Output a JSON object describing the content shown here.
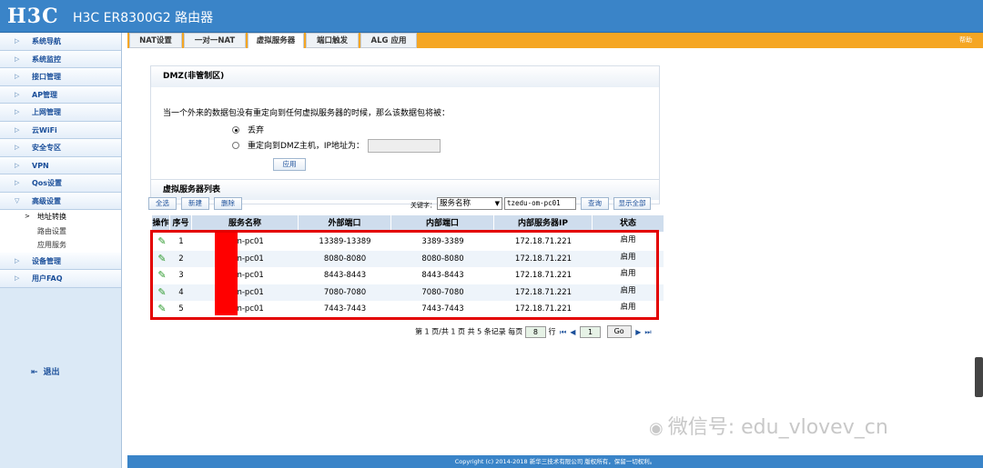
{
  "header": {
    "logo": "H3C",
    "product": "H3C ER8300G2 路由器"
  },
  "sidebar": {
    "items": [
      {
        "label": "系统导航"
      },
      {
        "label": "系统监控"
      },
      {
        "label": "接口管理"
      },
      {
        "label": "AP管理"
      },
      {
        "label": "上网管理"
      },
      {
        "label": "云WiFi"
      },
      {
        "label": "安全专区"
      },
      {
        "label": "VPN"
      },
      {
        "label": "Qos设置"
      },
      {
        "label": "高级设置"
      }
    ],
    "subitems": [
      {
        "label": "地址转换"
      },
      {
        "label": "路由设置"
      },
      {
        "label": "应用服务"
      }
    ],
    "items2": [
      {
        "label": "设备管理"
      },
      {
        "label": "用户FAQ"
      }
    ],
    "logout": "退出"
  },
  "tabs": [
    {
      "label": "NAT设置"
    },
    {
      "label": "一对一NAT"
    },
    {
      "label": "虚拟服务器"
    },
    {
      "label": "端口触发"
    },
    {
      "label": "ALG 应用"
    }
  ],
  "help": "帮助",
  "dmz": {
    "title": "DMZ(非管制区)",
    "description": "当一个外来的数据包没有重定向到任何虚拟服务器的时候，那么该数据包将被：",
    "opt_discard": "丢弃",
    "opt_redirect": "重定向到DMZ主机，IP地址为：",
    "ip_value": "",
    "apply": "应用"
  },
  "vs": {
    "title": "虚拟服务器列表",
    "btn_select_all": "全选",
    "btn_new": "新建",
    "btn_delete": "删除",
    "keyword_label": "关键字：",
    "keyword_field": "服务名称",
    "keyword_value": "tzedu-om-pc01",
    "btn_query": "查询",
    "btn_show_all": "显示全部",
    "columns": [
      "操作",
      "序号",
      "服务名称",
      "外部端口",
      "内部端口",
      "内部服务器IP",
      "状态"
    ],
    "rows": [
      {
        "no": "1",
        "name": "-om-pc01",
        "ext": "13389-13389",
        "int": "3389-3389",
        "ip": "172.18.71.221",
        "status": "启用"
      },
      {
        "no": "2",
        "name": "-om-pc01",
        "ext": "8080-8080",
        "int": "8080-8080",
        "ip": "172.18.71.221",
        "status": "启用"
      },
      {
        "no": "3",
        "name": "-om-pc01",
        "ext": "8443-8443",
        "int": "8443-8443",
        "ip": "172.18.71.221",
        "status": "启用"
      },
      {
        "no": "4",
        "name": "-om-pc01",
        "ext": "7080-7080",
        "int": "7080-7080",
        "ip": "172.18.71.221",
        "status": "启用"
      },
      {
        "no": "5",
        "name": "-om-pc01",
        "ext": "7443-7443",
        "int": "7443-7443",
        "ip": "172.18.71.221",
        "status": "启用"
      }
    ],
    "pager": {
      "summary": "第 1 页/共 1 页 共 5 条记录 每页",
      "per_page": "8",
      "unit": "行",
      "page": "1",
      "go": "Go"
    }
  },
  "footer": "Copyright (c) 2014-2018 新华三技术有限公司 版权所有，保留一切权利。",
  "watermark": "微信号: edu_vlovev_cn",
  "colors": {
    "header": "#3a84c8",
    "tabbar": "#f5a623",
    "highlight": "#e30000",
    "redact": "#ff0000"
  }
}
